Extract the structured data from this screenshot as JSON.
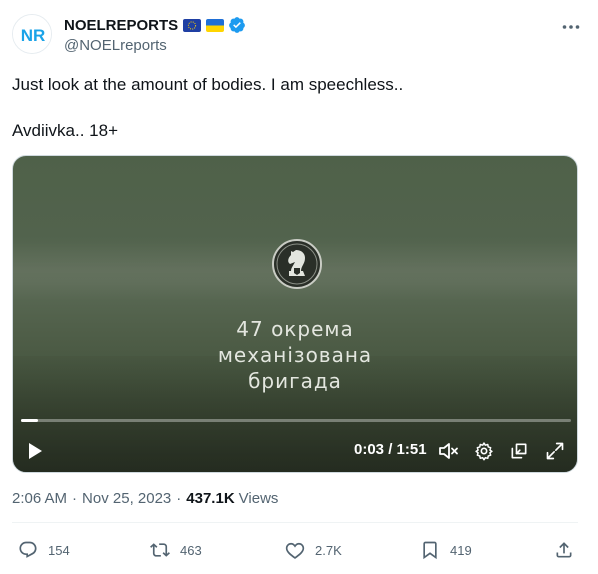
{
  "author": {
    "display_name": "NOELREPORTS",
    "handle": "@NOELreports",
    "avatar_text": "NR",
    "flags": [
      "eu-flag-icon",
      "ukraine-flag-icon"
    ],
    "verified": true
  },
  "tweet": {
    "line1": "Just look at the amount of bodies. I am speechless..",
    "line2": "Avdiivka.. 18+"
  },
  "video": {
    "caption_line1": "47 окрема",
    "caption_line2": "механізована",
    "caption_line3": "бригада",
    "time_display": "0:03 / 1:51",
    "progress": 0.03
  },
  "meta": {
    "time": "2:06 AM",
    "date": "Nov 25, 2023",
    "views_count": "437.1K",
    "views_label": "Views"
  },
  "actions": {
    "replies": "154",
    "reposts": "463",
    "likes": "2.7K",
    "bookmarks": "419"
  },
  "colors": {
    "text_primary": "#0f1419",
    "text_secondary": "#536471",
    "verified_blue": "#1d9bf0",
    "brand_blue": "#1aa3e8"
  }
}
